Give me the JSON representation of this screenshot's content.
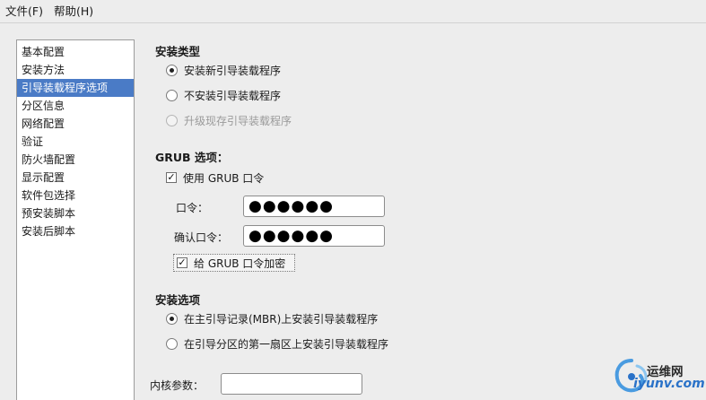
{
  "menubar": {
    "items": [
      "文件(F)",
      "帮助(H)"
    ]
  },
  "sidebar": {
    "items": [
      {
        "label": "基本配置",
        "selected": false
      },
      {
        "label": "安装方法",
        "selected": false
      },
      {
        "label": "引导装载程序选项",
        "selected": true
      },
      {
        "label": "分区信息",
        "selected": false
      },
      {
        "label": "网络配置",
        "selected": false
      },
      {
        "label": "验证",
        "selected": false
      },
      {
        "label": "防火墙配置",
        "selected": false
      },
      {
        "label": "显示配置",
        "selected": false
      },
      {
        "label": "软件包选择",
        "selected": false
      },
      {
        "label": "预安装脚本",
        "selected": false
      },
      {
        "label": "安装后脚本",
        "selected": false
      }
    ]
  },
  "install_type": {
    "title": "安装类型",
    "options": [
      {
        "label": "安装新引导装载程序",
        "checked": true,
        "disabled": false
      },
      {
        "label": "不安装引导装载程序",
        "checked": false,
        "disabled": false
      },
      {
        "label": "升级现存引导装载程序",
        "checked": false,
        "disabled": true
      }
    ]
  },
  "grub": {
    "title": "GRUB 选项：",
    "use_password_label": "使用 GRUB 口令",
    "use_password_checked": true,
    "password_label": "口令：",
    "password_value": "●●●●●●",
    "confirm_label": "确认口令：",
    "confirm_value": "●●●●●●",
    "encrypt_label": "给 GRUB 口令加密",
    "encrypt_checked": true
  },
  "install_options": {
    "title": "安装选项",
    "options": [
      {
        "label": "在主引导记录(MBR)上安装引导装载程序",
        "checked": true
      },
      {
        "label": "在引导分区的第一扇区上安装引导装载程序",
        "checked": false
      }
    ]
  },
  "kernel": {
    "label": "内核参数：",
    "value": ""
  },
  "watermark": {
    "title": "运维网",
    "domain": "iyunv.com"
  },
  "colors": {
    "selection": "#4a7bc6",
    "background": "#ededed",
    "watermark_accent": "#2a72c8"
  }
}
